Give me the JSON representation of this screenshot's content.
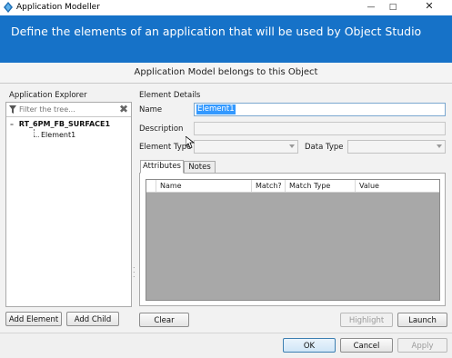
{
  "window": {
    "title": "Application Modeller",
    "app_icon": "blue-prism-icon",
    "buttons": [
      "minimize",
      "maximize",
      "close"
    ]
  },
  "banner": {
    "text": "Define the elements of an application that will be used by Object Studio",
    "color": "#1672c8"
  },
  "subheader": "Application Model belongs to this Object",
  "explorer": {
    "title": "Application Explorer",
    "filter_placeholder": "Filter the tree...",
    "tree": {
      "root": "RT_6PM_FB_SURFACE1",
      "child": "Element1"
    },
    "add_element": "Add Element",
    "add_child": "Add Child"
  },
  "details": {
    "title": "Element Details",
    "name_label": "Name",
    "name_value": "Element1",
    "description_label": "Description",
    "element_type_label": "Element Type",
    "data_type_label": "Data Type",
    "tabs": [
      {
        "label": "Attributes",
        "active": true
      },
      {
        "label": "Notes",
        "active": false
      }
    ],
    "columns": [
      "Name",
      "Match?",
      "Match Type",
      "Value"
    ],
    "clear": "Clear",
    "highlight": "Highlight",
    "launch": "Launch"
  },
  "footer": {
    "ok": "OK",
    "cancel": "Cancel",
    "apply": "Apply"
  }
}
